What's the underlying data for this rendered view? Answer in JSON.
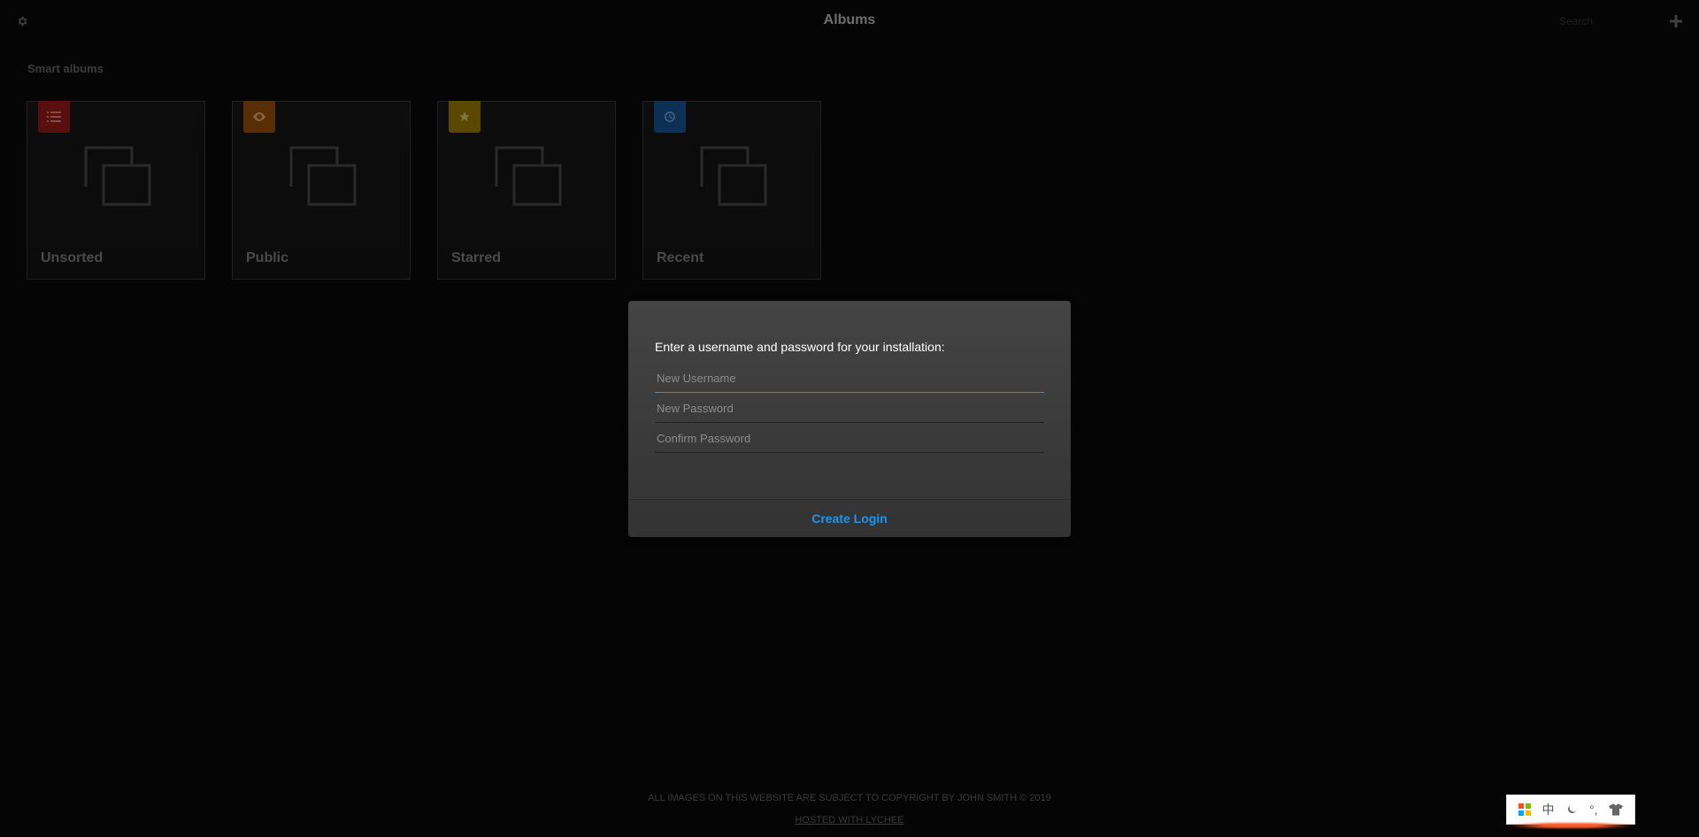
{
  "header": {
    "title": "Albums",
    "search_placeholder": "Search"
  },
  "smart_albums": {
    "section_title": "Smart albums",
    "items": [
      {
        "label": "Unsorted",
        "icon": "list-icon",
        "badge_color": "#b41e1e"
      },
      {
        "label": "Public",
        "icon": "eye-icon",
        "badge_color": "#d46b08"
      },
      {
        "label": "Starred",
        "icon": "star-icon",
        "badge_color": "#d4a900"
      },
      {
        "label": "Recent",
        "icon": "clock-icon",
        "badge_color": "#1c6fc2"
      }
    ]
  },
  "login_modal": {
    "message": "Enter a username and password for your installation:",
    "username_placeholder": "New Username",
    "password_placeholder": "New Password",
    "confirm_placeholder": "Confirm Password",
    "submit_label": "Create Login",
    "accent_color": "#2293ec"
  },
  "footer": {
    "copyright": "ALL IMAGES ON THIS WEBSITE ARE SUBJECT TO COPYRIGHT BY JOHN SMITH © 2019",
    "hosted_link": "HOSTED WITH LYCHEE"
  },
  "ime_toolbar": {
    "items": [
      "grid-icon",
      "中",
      "moon-icon",
      "°,",
      "shirt-icon"
    ]
  }
}
